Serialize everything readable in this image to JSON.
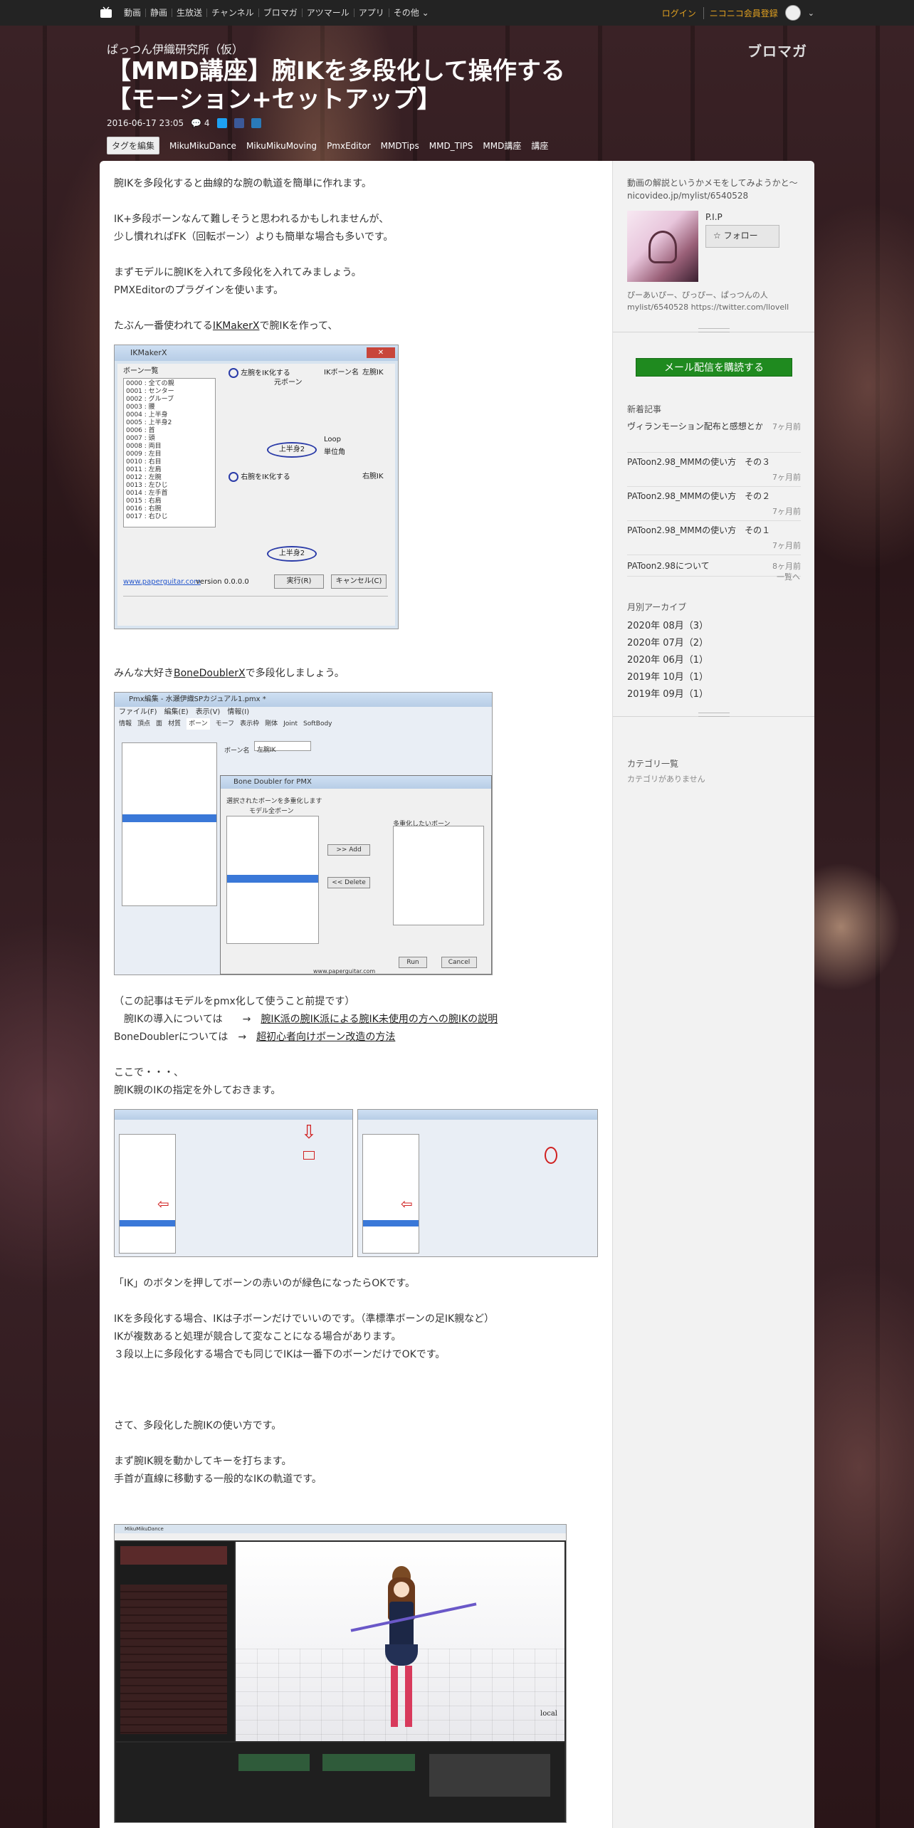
{
  "nav": {
    "links": [
      "動画",
      "静画",
      "生放送",
      "チャンネル",
      "ブロマガ",
      "アツマール",
      "アプリ",
      "その他"
    ],
    "login": "ログイン",
    "signup": "ニコニコ会員登録"
  },
  "blog": {
    "name": "ぱっつん伊織研究所（仮）",
    "brand": "ブロマガ",
    "title_line1": "【MMD講座】腕IKを多段化して操作する",
    "title_line2": "【モーション+セットアップ】",
    "date": "2016-06-17 23:05",
    "comments": "4",
    "tag_edit": "タグを編集",
    "tags": [
      "MikuMikuDance",
      "MikuMikuMoving",
      "PmxEditor",
      "MMDTips",
      "MMD_TIPS",
      "MMD講座",
      "講座"
    ]
  },
  "article": {
    "p1": "腕IKを多段化すると曲線的な腕の軌道を簡単に作れます。",
    "p2a": "IK+多段ボーンなんて難しそうと思われるかもしれませんが、",
    "p2b": "少し慣れればFK（回転ボーン）よりも簡単な場合も多いです。",
    "p3a": "まずモデルに腕IKを入れて多段化を入れてみましょう。",
    "p3b": "PMXEditorのプラグインを使います。",
    "p4_pre": "たぶん一番使われてる",
    "p4_link": "IKMakerX",
    "p4_post": "で腕IKを作って、",
    "ikmaker": {
      "title": "IKMakerX",
      "bone_list": "ボーン一覧",
      "left_ik": "左腕をIK化する",
      "right_ik": "右腕をIK化する",
      "moto": "元ボーン",
      "ik_bone": "IKボーン名",
      "left_ik_name": "左腕IK",
      "right_ik_name": "右腕IK",
      "loop": "Loop",
      "unit": "単位角",
      "parent_opt": "上半身2",
      "run": "実行(R)",
      "cancel": "キャンセル(C)",
      "url": "www.paperguitar.com",
      "version": "version 0.0.0.0"
    },
    "p5_pre": "みんな大好き",
    "p5_link": "BoneDoublerX",
    "p5_post": "で多段化しましょう。",
    "pmx": {
      "title": "Pmx編集 - 水瀬伊織SPカジュアル1.pmx *",
      "menus": [
        "ファイル(F)",
        "編集(E)",
        "表示(V)",
        "情報(I)"
      ],
      "tabs": [
        "情報",
        "頂点",
        "面",
        "材質",
        "ボーン",
        "モーフ",
        "表示枠",
        "剛体",
        "Joint",
        "SoftBody"
      ],
      "bone_name_label": "ボーン名",
      "bone_name": "左腕IK",
      "dialog_title": "Bone Doubler for PMX",
      "select_label": "選択されたボーンを多重化します",
      "model_bones": "モデル全ボーン",
      "add": ">> Add",
      "delete": "<< Delete",
      "multiplex": "多重化したいボーン",
      "run": "Run",
      "cancel": "Cancel",
      "url": "www.paperguitar.com"
    },
    "p6": "（この記事はモデルをpmx化して使うこと前提です）",
    "p7_pre": "　腕IKの導入については　　→　",
    "p7_link": "腕IK派の腕IK派による腕IK未使用の方への腕IKの説明",
    "p8_pre": "BoneDoublerについては　→　",
    "p8_link": "超初心者向けボーン改造の方法",
    "p9a": "ここで・・・、",
    "p9b": "腕IK親のIKの指定を外しておきます。",
    "p10": "「IK」のボタンを押してボーンの赤いのが緑色になったらOKです。",
    "p11a": "IKを多段化する場合、IKは子ボーンだけでいいのです。（準標準ボーンの足IK親など）",
    "p11b": "IKが複数あると処理が競合して変なことになる場合があります。",
    "p11c": "３段以上に多段化する場合でも同じでIKは一番下のボーンだけでOKです。",
    "p12": "さて、多段化した腕IKの使い方です。",
    "p13a": "まず腕IK親を動かしてキーを打ちます。",
    "p13b": "手首が直線に移動する一般的なIKの軌道です。",
    "mmd": {
      "title": "MikuMikuDance",
      "local": "local"
    }
  },
  "sidebar": {
    "desc": "動画の解説というかメモをしてみようかと～ nicovideo.jp/mylist/6540528",
    "user": "P.I.P",
    "follow": "フォロー",
    "profile": "ぴーあいぴー、ぴっぴー、ぱっつんの人 mylist/6540528 https://twitter.com/llovell",
    "mail_button": "メール配信を購読する",
    "recent_title": "新着記事",
    "recent": [
      {
        "title": "ヴィランモーション配布と感想とか",
        "date": "7ヶ月前"
      },
      {
        "title": "PAToon2.98_MMMの使い方　その３",
        "date": "7ヶ月前"
      },
      {
        "title": "PAToon2.98_MMMの使い方　その２",
        "date": "7ヶ月前"
      },
      {
        "title": "PAToon2.98_MMMの使い方　その１",
        "date": "7ヶ月前"
      },
      {
        "title": "PAToon2.98について",
        "date": "8ヶ月前"
      }
    ],
    "more": "一覧へ",
    "archive_title": "月別アーカイブ",
    "archive": [
      "2020年 08月（3）",
      "2020年 07月（2）",
      "2020年 06月（1）",
      "2019年 10月（1）",
      "2019年 09月（1）"
    ],
    "category_title": "カテゴリ一覧",
    "category_empty": "カテゴリがありません"
  }
}
